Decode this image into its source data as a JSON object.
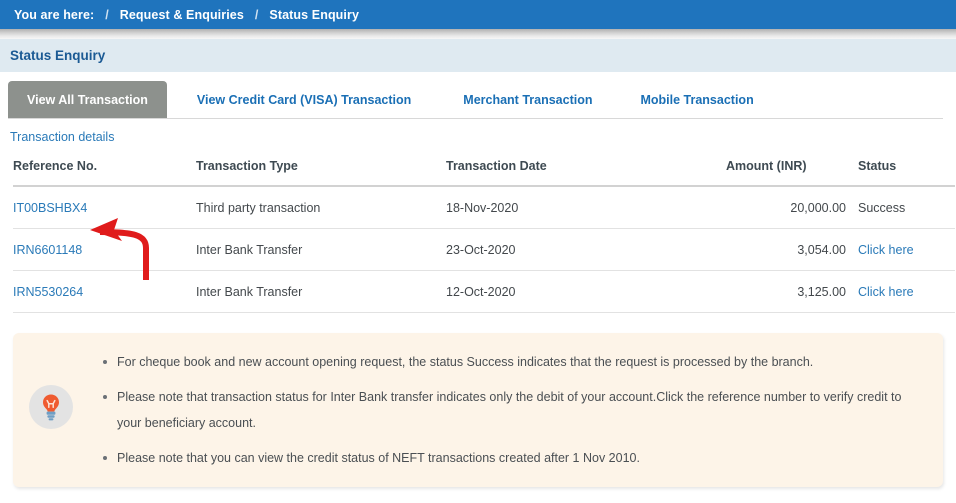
{
  "breadcrumb": {
    "prefix": "You are here:",
    "separator": "/",
    "items": [
      "Request & Enquiries",
      "Status Enquiry"
    ]
  },
  "page": {
    "title": "Status Enquiry"
  },
  "tabs": [
    {
      "label": "View All Transaction",
      "active": true
    },
    {
      "label": "View Credit Card (VISA) Transaction",
      "active": false
    },
    {
      "label": "Merchant Transaction",
      "active": false
    },
    {
      "label": "Mobile Transaction",
      "active": false
    }
  ],
  "section": {
    "details_link": "Transaction details"
  },
  "table": {
    "headers": [
      "Reference No.",
      "Transaction Type",
      "Transaction Date",
      "Amount (INR)",
      "Status"
    ],
    "rows": [
      {
        "reference": "IT00BSHBX4",
        "type": "Third party transaction",
        "date": "18-Nov-2020",
        "amount": "20,000.00",
        "status": "Success"
      },
      {
        "reference": "IRN6601148",
        "type": "Inter Bank Transfer",
        "date": "23-Oct-2020",
        "amount": "3,054.00",
        "status": "Click here"
      },
      {
        "reference": "IRN5530264",
        "type": "Inter Bank Transfer",
        "date": "12-Oct-2020",
        "amount": "3,125.00",
        "status": "Click here"
      }
    ]
  },
  "notice": {
    "icon": "lightbulb-icon",
    "bullets": [
      "For cheque book and new account opening request, the status Success indicates that the request is processed by the branch.",
      "Please note that transaction status for Inter Bank transfer indicates only the debit of your account.Click the reference number to verify credit to your beneficiary account.",
      "Please note that you can view the credit status of NEFT transactions created after 1 Nov 2010."
    ]
  },
  "annotation": {
    "type": "red-arrow",
    "color": "#e01b1b",
    "points_to": "IT00BSHBX4"
  },
  "colors": {
    "breadcrumb_bar": "#1f74bd",
    "title_bar": "#dfeaf1",
    "title_text": "#1b5a94",
    "active_tab": "#8d918d",
    "link": "#2a7ab8",
    "notice_bg": "#fdf4e8"
  }
}
